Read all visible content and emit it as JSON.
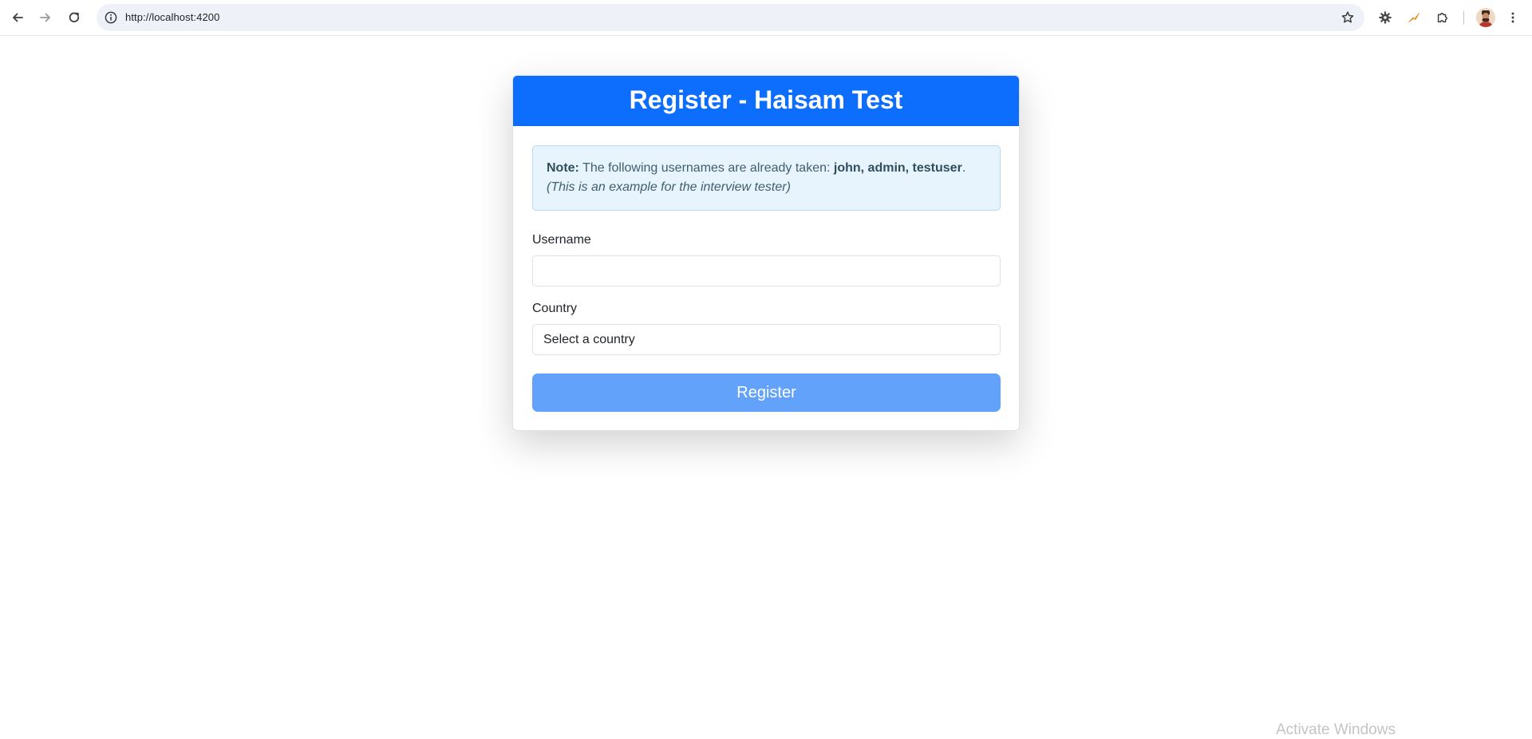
{
  "browser": {
    "url": "http://localhost:4200"
  },
  "card": {
    "title": "Register - Haisam Test",
    "note": {
      "label": "Note:",
      "text": "The following usernames are already taken:",
      "usernames": "john, admin, testuser",
      "period": ".",
      "example": "(This is an example for the interview tester)"
    },
    "username": {
      "label": "Username",
      "value": ""
    },
    "country": {
      "label": "Country",
      "selected": "Select a country"
    },
    "register_label": "Register"
  },
  "colors": {
    "header": "#0d6efd",
    "button": "#62a2fb",
    "alert_bg": "#e7f3fd"
  },
  "watermark": "Activate Windows"
}
